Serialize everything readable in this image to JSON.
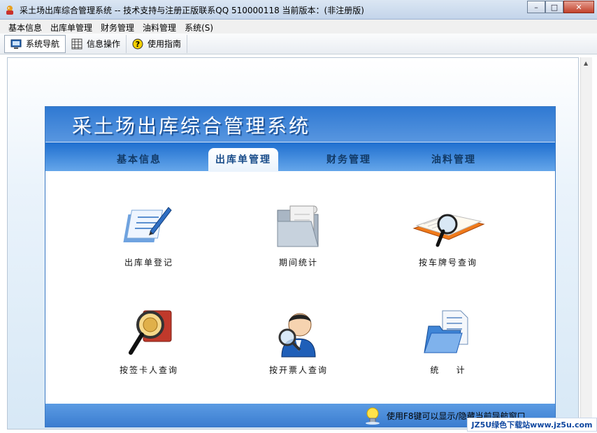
{
  "window": {
    "title": "采土场出库综合管理系统 -- 技术支持与注册正版联系QQ 510000118    当前版本：(非注册版)",
    "minimize": "–",
    "maximize": "□",
    "close": "✕"
  },
  "menu": [
    "基本信息",
    "出库单管理",
    "财务管理",
    "油料管理",
    "系统(S)"
  ],
  "toolbar": {
    "nav_label": "系统导航",
    "info_label": "信息操作",
    "guide_label": "使用指南"
  },
  "panel": {
    "title": "采土场出库综合管理系统",
    "tabs": [
      "基本信息",
      "出库单管理",
      "财务管理",
      "油料管理"
    ],
    "active_tab": 1,
    "items": [
      {
        "label": "出库单登记",
        "icon": "document-pen-icon"
      },
      {
        "label": "期间统计",
        "icon": "folder-scroll-icon"
      },
      {
        "label": "按车牌号查询",
        "icon": "book-magnifier-icon"
      },
      {
        "label": "按签卡人查询",
        "icon": "magnifier-coin-icon"
      },
      {
        "label": "按开票人查询",
        "icon": "person-magnifier-icon"
      },
      {
        "label": "统    计",
        "icon": "folder-document-icon"
      }
    ],
    "footer_hint": "使用F8键可以显示/隐藏当前导航窗口"
  },
  "watermark": "JZ5U绿色下载站www.jz5u.com",
  "colors": {
    "header_blue": "#2f79d2",
    "tab_text": "#123a66",
    "footer_blue": "#4a8bd9"
  }
}
